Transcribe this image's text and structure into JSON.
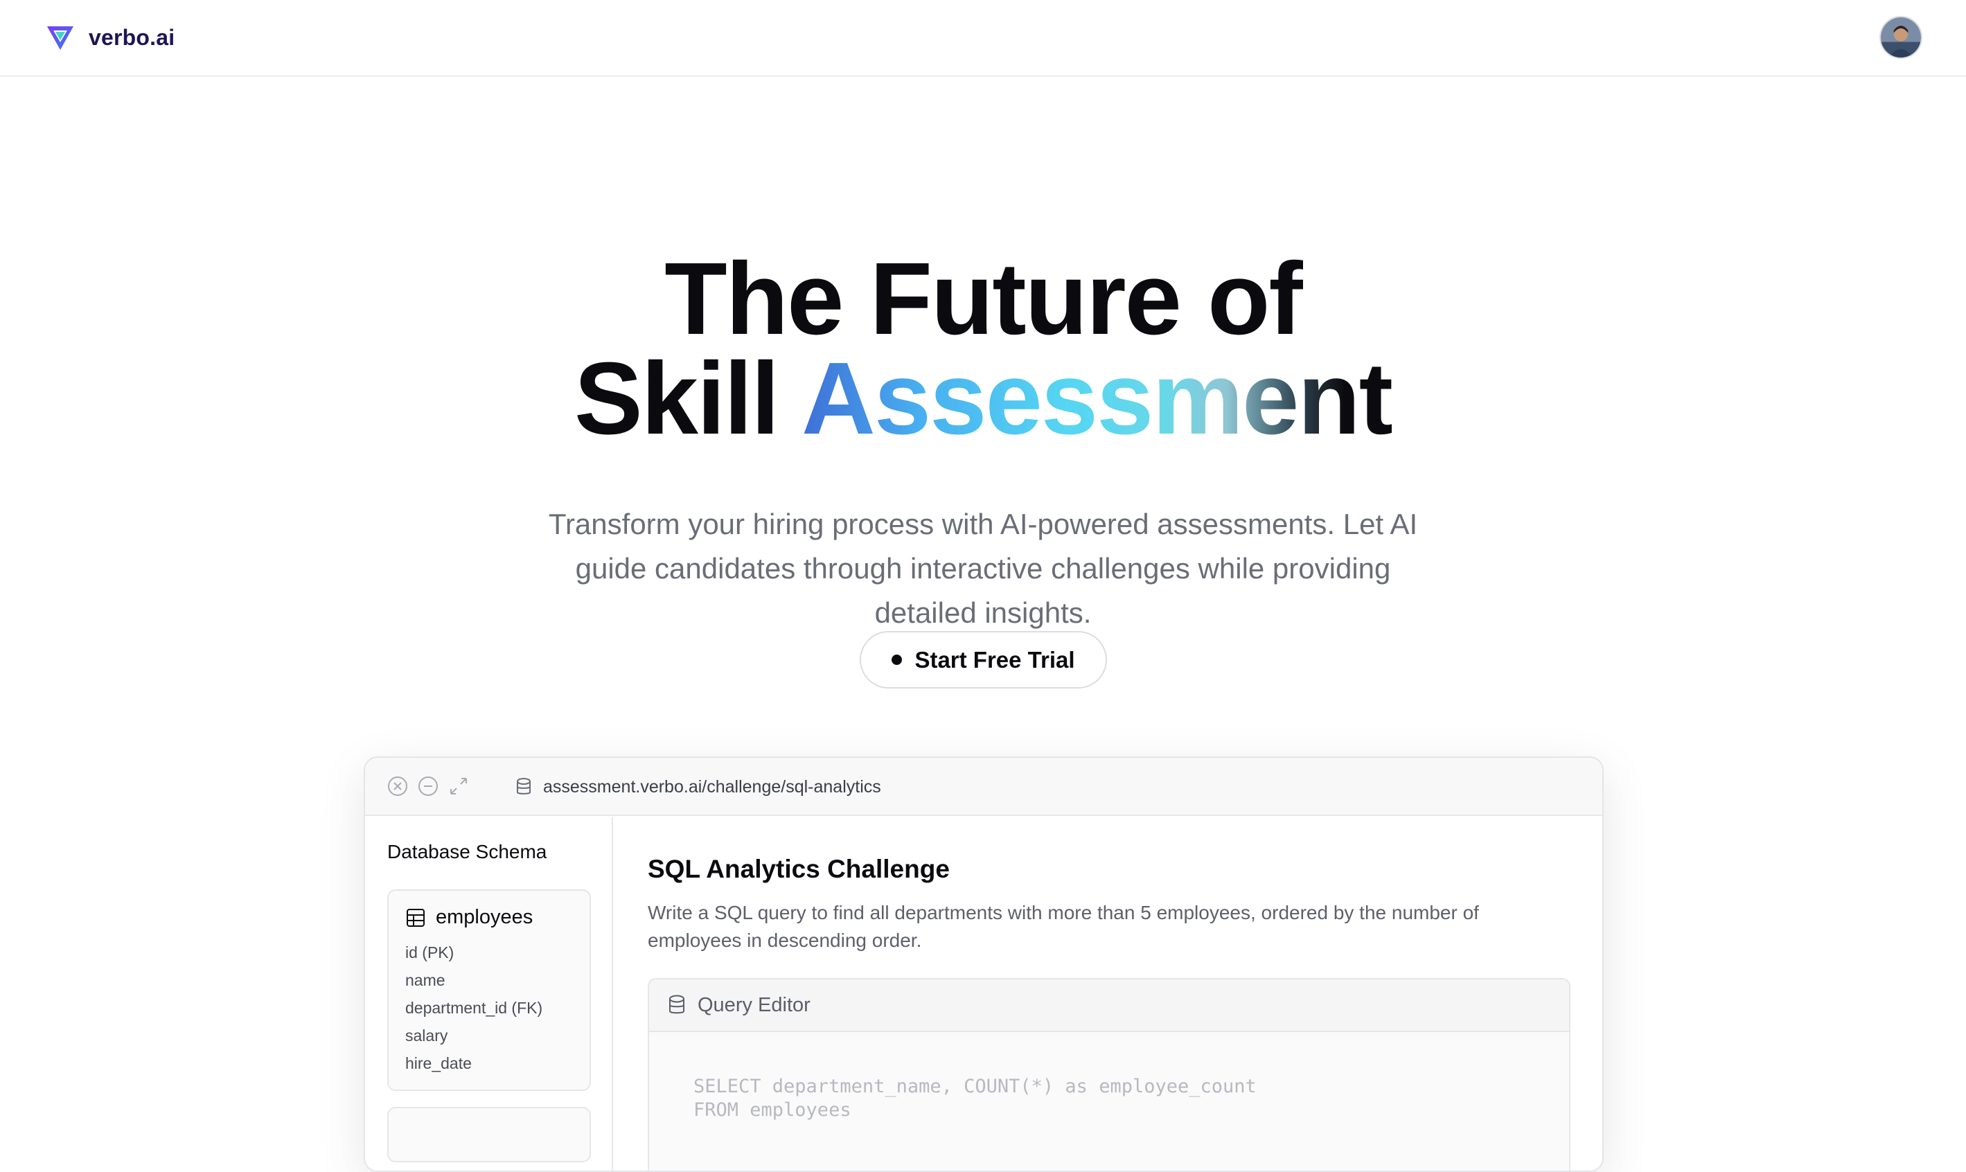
{
  "brand": {
    "name": "verbo.ai",
    "logo_icon": "verbo-triangle-logo"
  },
  "header": {
    "avatar_icon": "user-avatar"
  },
  "hero": {
    "title_line1": "The Future of",
    "title_line2_plain": "Skill ",
    "title_line2_gradient": "Assessment",
    "subtitle": "Transform your hiring process with AI-powered assessments. Let AI guide candidates through interactive challenges while providing detailed insights.",
    "cta_label": "Start Free Trial"
  },
  "preview_window": {
    "url": "assessment.verbo.ai/challenge/sql-analytics",
    "controls": [
      "close-icon",
      "minimize-icon",
      "expand-icon"
    ],
    "sidebar": {
      "title": "Database Schema",
      "tables": [
        {
          "name": "employees",
          "columns": [
            "id (PK)",
            "name",
            "department_id (FK)",
            "salary",
            "hire_date"
          ]
        }
      ]
    },
    "main": {
      "title": "SQL Analytics Challenge",
      "description": "Write a SQL query to find all departments with more than 5 employees, ordered by the number of employees in descending order.",
      "editor": {
        "label": "Query Editor",
        "code_lines": [
          "SELECT department_name, COUNT(*) as employee_count",
          "FROM employees"
        ]
      }
    }
  },
  "colors": {
    "brand_text": "#1c1656",
    "gradient_start": "#3f6fd6",
    "gradient_mid": "#55d6f2",
    "muted_text": "#6a6d76"
  }
}
